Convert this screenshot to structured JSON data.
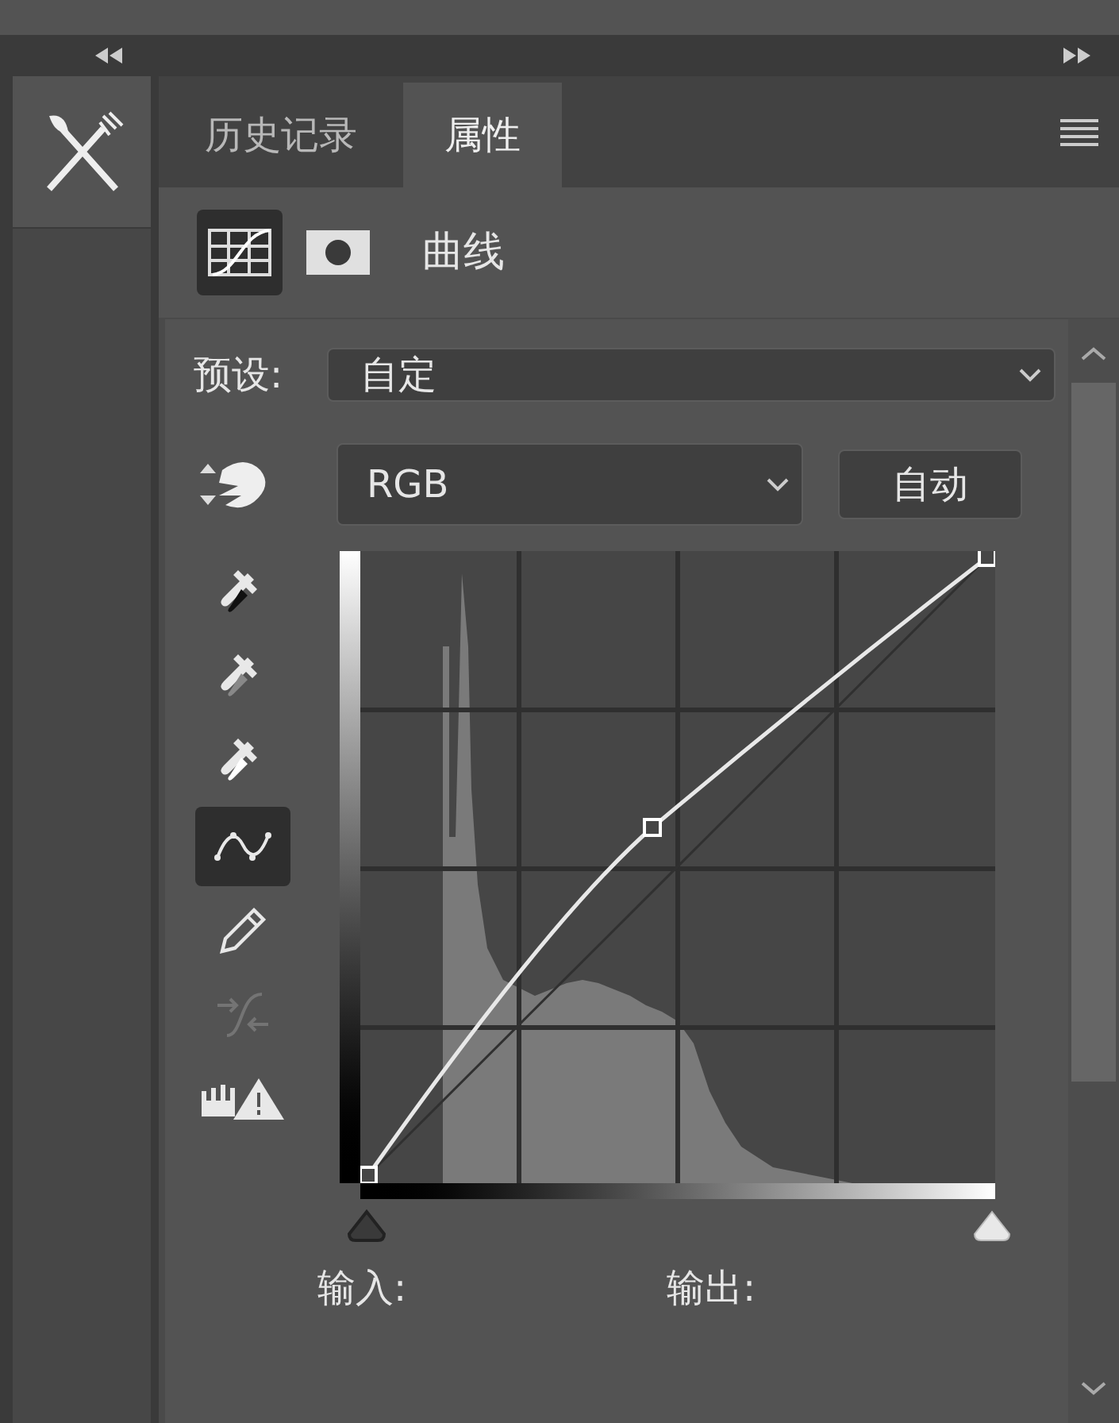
{
  "tabs": [
    {
      "label": "历史记录",
      "selected": false
    },
    {
      "label": "属性",
      "selected": true
    }
  ],
  "modes": [
    {
      "kind": "adjustment",
      "selected": true
    },
    {
      "kind": "mask",
      "selected": false
    }
  ],
  "title": "曲线",
  "preset": {
    "label": "预设:",
    "value": "自定"
  },
  "channel": {
    "value": "RGB"
  },
  "auto_button": "自动",
  "tools": [
    {
      "kind": "black",
      "selected": false,
      "disabled": false
    },
    {
      "kind": "gray",
      "selected": false,
      "disabled": false
    },
    {
      "kind": "white",
      "selected": false,
      "disabled": false
    },
    {
      "kind": "curve",
      "selected": true,
      "disabled": false
    },
    {
      "kind": "pencil",
      "selected": false,
      "disabled": false
    },
    {
      "kind": "smooth",
      "selected": false,
      "disabled": true
    },
    {
      "kind": "clipping",
      "selected": false,
      "disabled": false
    }
  ],
  "input_label": "输入:",
  "output_label": "输出:"
}
